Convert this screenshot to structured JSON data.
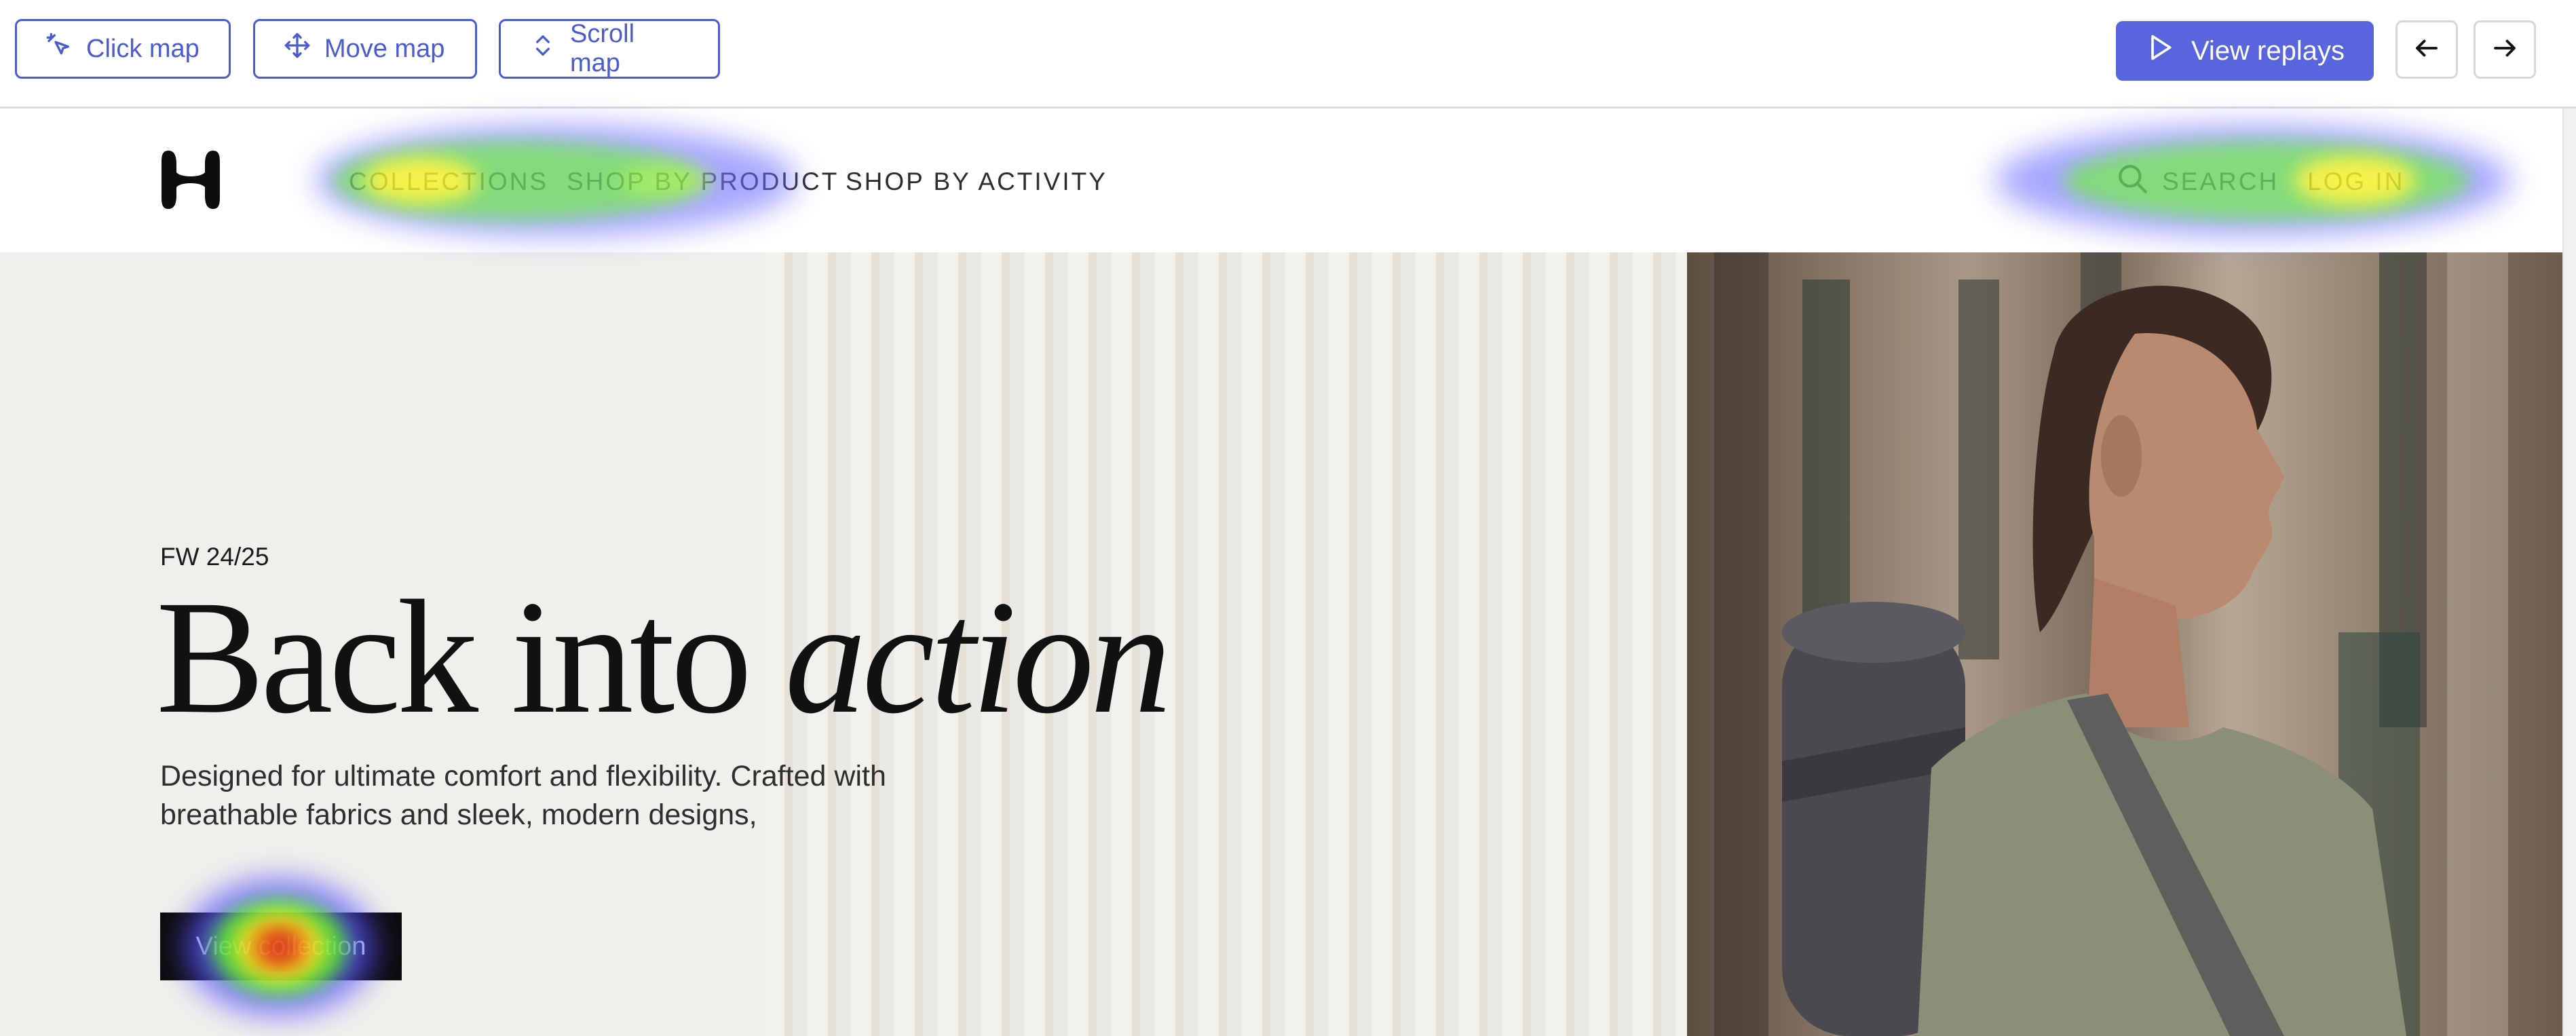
{
  "toolbar": {
    "click_map_label": "Click map",
    "move_map_label": "Move map",
    "scroll_map_label": "Scroll map",
    "view_replays_label": "View replays",
    "accent_color": "#5965dc"
  },
  "site": {
    "nav": {
      "collections": "COLLECTIONS",
      "shop_by_product": "SHOP BY PRODUCT",
      "shop_by_activity": "SHOP BY ACTIVITY",
      "search": "SEARCH",
      "login": "LOG IN"
    },
    "hero": {
      "eyebrow": "FW 24/25",
      "headline_regular": "Back into ",
      "headline_italic": "action",
      "subcopy": "Designed for ultimate comfort and flexibility. Crafted with breathable fabrics and sleek, modern designs,",
      "cta_label": "View collection"
    }
  },
  "icons": {
    "click_map": "cursor-click-icon",
    "move_map": "move-arrows-icon",
    "scroll_map": "scroll-chevrons-icon",
    "replay": "play-icon",
    "prev": "arrow-left-icon",
    "next": "arrow-right-icon",
    "search": "search-icon",
    "logo": "brand-logo"
  }
}
